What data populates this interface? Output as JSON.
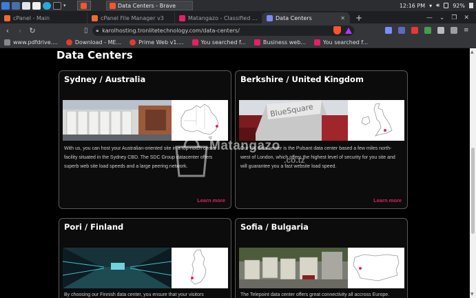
{
  "taskbar": {
    "active_task": "Data Centers - Brave",
    "clock": "12:16 PM",
    "battery": "92%"
  },
  "tabs": [
    {
      "title": "cPanel - Main",
      "favicon_color": "#f26a2e",
      "active": false
    },
    {
      "title": "cPanel File Manager v3",
      "favicon_color": "#f26a2e",
      "active": false
    },
    {
      "title": "Matangazo - Classified & Pro",
      "favicon_color": "#e91e63",
      "active": false
    },
    {
      "title": "Data Centers",
      "favicon_color": "#7b8cff",
      "active": true
    }
  ],
  "navbar": {
    "url": "karolhosting.tronlitetechnology.com/data-centers/"
  },
  "bookmarks": [
    {
      "label": "www.pdfdrive....",
      "favicon_color": "#888888"
    },
    {
      "label": "Download - ME...",
      "favicon_color": "#e53935"
    },
    {
      "label": "Prime Web v1....",
      "favicon_color": "#e53935"
    },
    {
      "label": "You searched f...",
      "favicon_color": "#e91e63"
    },
    {
      "label": "Business web...",
      "favicon_color": "#e91e63"
    },
    {
      "label": "You searched f...",
      "favicon_color": "#e91e63"
    }
  ],
  "page": {
    "title": "Data Centers"
  },
  "cards": [
    {
      "title": "Sydney / Australia",
      "text": "With us, you can host your Australian-oriented site in a top-notch center facility situated in the Sydney CBD. The SDC Group datacenter offers superb web site load speeds and a large peering network.",
      "link": "Learn more",
      "map": "australia"
    },
    {
      "title": "Berkshire / United Kingdom",
      "text": "Our UK data center is the Pulsant data center based a few miles north-west of London, which offers the highest level of security for you site and will guarantee you a fast website load speed.",
      "link": "Learn more",
      "map": "uk"
    },
    {
      "title": "Pori / Finland",
      "text": "By choosing our Finnish data center, you ensure that your visitors",
      "link": "",
      "map": "finland"
    },
    {
      "title": "Sofia / Bulgaria",
      "text": "The Telepoint data center offers great connectivity all accross Europe.",
      "link": "",
      "map": "bulgaria"
    }
  ],
  "watermark": {
    "text": "Matangazo",
    "sub": ".co.tz"
  },
  "colors": {
    "accent_link": "#e0245e",
    "page_bg": "#000000",
    "brave_orange": "#fb542b"
  }
}
